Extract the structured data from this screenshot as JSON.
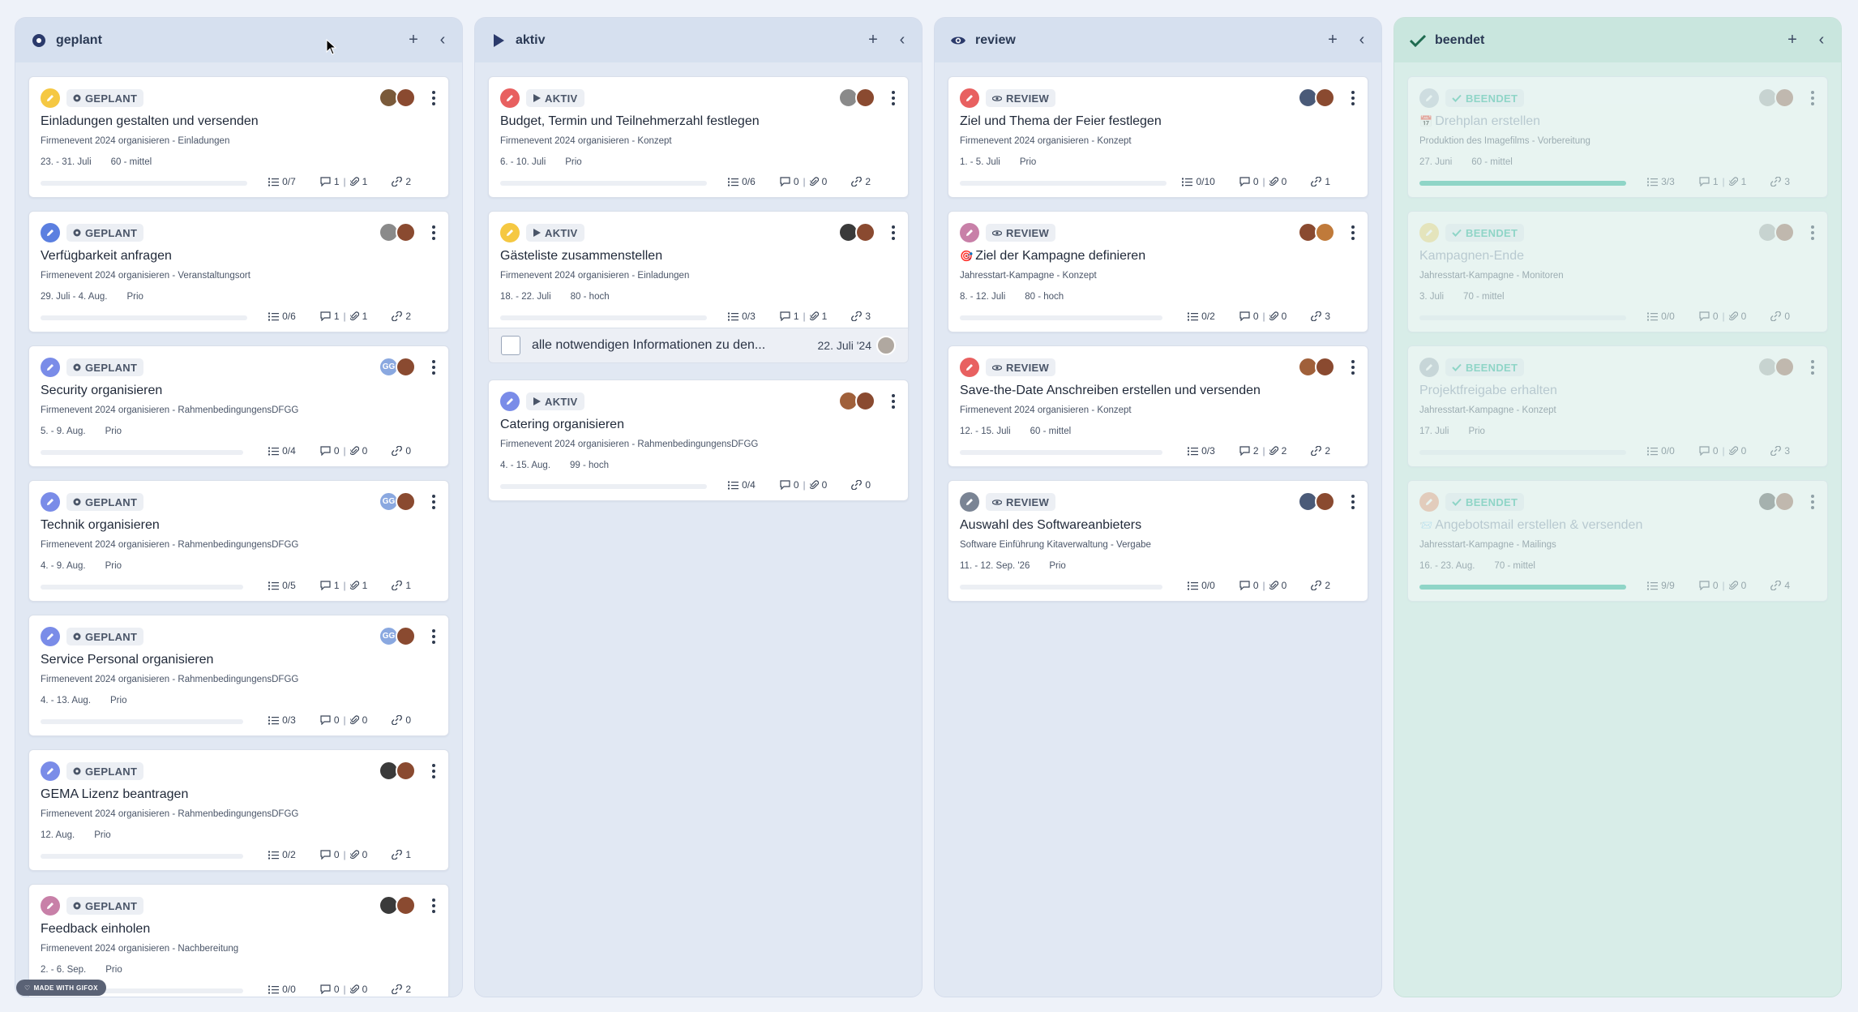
{
  "columns": [
    {
      "id": "geplant",
      "title": "geplant",
      "icon": "circle-dot-icon",
      "cards": [
        {
          "edit_color": "#f5c842",
          "status": "GEPLANT",
          "status_icon": "circle-dot-icon",
          "title": "Einladungen gestalten und versenden",
          "project": "Firmenevent 2024 organisieren - Einladungen",
          "date": "23. - 31. Juli",
          "prio": "60 - mittel",
          "checklist": "0/7",
          "comments": "1",
          "files": "1",
          "links": "2",
          "progress": 0,
          "avatars": [
            "#7a5a3a",
            "#8a4a30"
          ]
        },
        {
          "edit_color": "#5b7fe0",
          "status": "GEPLANT",
          "status_icon": "circle-dot-icon",
          "title": "Verfügbarkeit anfragen",
          "project": "Firmenevent 2024 organisieren - Veranstaltungsort",
          "date": "29. Juli - 4. Aug.",
          "prio": "Prio",
          "checklist": "0/6",
          "comments": "1",
          "files": "1",
          "links": "2",
          "progress": 0,
          "avatars": [
            "#8a8a8a",
            "#8a4a30"
          ]
        },
        {
          "edit_color": "#7a8ce8",
          "status": "GEPLANT",
          "status_icon": "circle-dot-icon",
          "title": "Security organisieren",
          "project": "Firmenevent 2024 organisieren - RahmenbedingungensDFGG",
          "date": "5. - 9. Aug.",
          "prio": "Prio",
          "checklist": "0/4",
          "comments": "0",
          "files": "0",
          "links": "0",
          "progress": 0,
          "avatars": [
            "#8aa8e0",
            "#8a4a30"
          ],
          "initials": "GG"
        },
        {
          "edit_color": "#7a8ce8",
          "status": "GEPLANT",
          "status_icon": "circle-dot-icon",
          "title": "Technik organisieren",
          "project": "Firmenevent 2024 organisieren - RahmenbedingungensDFGG",
          "date": "4. - 9. Aug.",
          "prio": "Prio",
          "checklist": "0/5",
          "comments": "1",
          "files": "1",
          "links": "1",
          "progress": 0,
          "avatars": [
            "#8aa8e0",
            "#8a4a30"
          ],
          "initials": "GG"
        },
        {
          "edit_color": "#7a8ce8",
          "status": "GEPLANT",
          "status_icon": "circle-dot-icon",
          "title": "Service Personal organisieren",
          "project": "Firmenevent 2024 organisieren - RahmenbedingungensDFGG",
          "date": "4. - 13. Aug.",
          "prio": "Prio",
          "checklist": "0/3",
          "comments": "0",
          "files": "0",
          "links": "0",
          "progress": 0,
          "avatars": [
            "#8aa8e0",
            "#8a4a30"
          ],
          "initials": "GG"
        },
        {
          "edit_color": "#7a8ce8",
          "status": "GEPLANT",
          "status_icon": "circle-dot-icon",
          "title": "GEMA Lizenz beantragen",
          "project": "Firmenevent 2024 organisieren - RahmenbedingungensDFGG",
          "date": "12. Aug.",
          "prio": "Prio",
          "checklist": "0/2",
          "comments": "0",
          "files": "0",
          "links": "1",
          "progress": 0,
          "avatars": [
            "#3a3a3a",
            "#8a4a30"
          ]
        },
        {
          "edit_color": "#c880a8",
          "status": "GEPLANT",
          "status_icon": "circle-dot-icon",
          "title": "Feedback einholen",
          "project": "Firmenevent 2024 organisieren - Nachbereitung",
          "date": "2. - 6. Sep.",
          "prio": "Prio",
          "checklist": "0/0",
          "comments": "0",
          "files": "0",
          "links": "2",
          "progress": 0,
          "avatars": [
            "#3a3a3a",
            "#8a4a30"
          ]
        }
      ]
    },
    {
      "id": "aktiv",
      "title": "aktiv",
      "icon": "play-icon",
      "cards": [
        {
          "edit_color": "#e86060",
          "status": "AKTIV",
          "status_icon": "play-icon",
          "title": "Budget, Termin und Teilnehmerzahl festlegen",
          "project": "Firmenevent 2024 organisieren - Konzept",
          "date": "6. - 10. Juli",
          "prio": "Prio",
          "checklist": "0/6",
          "comments": "0",
          "files": "0",
          "links": "2",
          "progress": 0,
          "avatars": [
            "#8a8a8a",
            "#8a4a30"
          ]
        },
        {
          "edit_color": "#f5c842",
          "status": "AKTIV",
          "status_icon": "play-icon",
          "title": "Gästeliste zusammenstellen",
          "project": "Firmenevent 2024 organisieren - Einladungen",
          "date": "18. - 22. Juli",
          "prio": "80 - hoch",
          "checklist": "0/3",
          "comments": "1",
          "files": "1",
          "links": "3",
          "progress": 0,
          "avatars": [
            "#3a3a3a",
            "#8a4a30"
          ]
        },
        {
          "edit_color": "#7a8ce8",
          "status": "AKTIV",
          "status_icon": "play-icon",
          "title": "Catering organisieren",
          "project": "Firmenevent 2024 organisieren - RahmenbedingungensDFGG",
          "date": "4. - 15. Aug.",
          "prio": "99 - hoch",
          "checklist": "0/4",
          "comments": "0",
          "files": "0",
          "links": "0",
          "progress": 0,
          "avatars": [
            "#a0603a",
            "#8a4a30"
          ]
        }
      ],
      "subtask": {
        "text": "alle notwendigen Informationen zu den...",
        "date": "22. Juli '24"
      }
    },
    {
      "id": "review",
      "title": "review",
      "icon": "eye-icon",
      "cards": [
        {
          "edit_color": "#e86060",
          "status": "REVIEW",
          "status_icon": "eye-icon",
          "title": "Ziel und Thema der Feier festlegen",
          "project": "Firmenevent 2024 organisieren - Konzept",
          "date": "1. - 5. Juli",
          "prio": "Prio",
          "checklist": "0/10",
          "comments": "0",
          "files": "0",
          "links": "1",
          "progress": 0,
          "avatars": [
            "#4a5a78",
            "#8a4a30"
          ]
        },
        {
          "edit_color": "#c880a8",
          "status": "REVIEW",
          "status_icon": "eye-icon",
          "title": "Ziel der Kampagne definieren",
          "emoji": "🎯",
          "project": "Jahresstart-Kampagne - Konzept",
          "date": "8. - 12. Juli",
          "prio": "80 - hoch",
          "checklist": "0/2",
          "comments": "0",
          "files": "0",
          "links": "3",
          "progress": 0,
          "avatars": [
            "#8a4a30",
            "#c07a3a"
          ]
        },
        {
          "edit_color": "#e86060",
          "status": "REVIEW",
          "status_icon": "eye-icon",
          "title": "Save-the-Date Anschreiben erstellen und versenden",
          "project": "Firmenevent 2024 organisieren - Konzept",
          "date": "12. - 15. Juli",
          "prio": "60 - mittel",
          "checklist": "0/3",
          "comments": "2",
          "files": "2",
          "links": "2",
          "progress": 0,
          "avatars": [
            "#a0603a",
            "#8a4a30"
          ]
        },
        {
          "edit_color": "#7a8494",
          "status": "REVIEW",
          "status_icon": "eye-icon",
          "title": "Auswahl des Softwareanbieters",
          "project": "Software Einführung Kitaverwaltung - Vergabe",
          "date": "11. - 12. Sep. '26",
          "prio": "Prio",
          "checklist": "0/0",
          "comments": "0",
          "files": "0",
          "links": "2",
          "progress": 0,
          "avatars": [
            "#4a5a78",
            "#8a4a30"
          ]
        }
      ]
    },
    {
      "id": "beendet",
      "title": "beendet",
      "icon": "check-icon",
      "cards": [
        {
          "edit_color": "#c0c8d4",
          "status": "BEENDET",
          "status_icon": "check-icon",
          "title": "Drehplan erstellen",
          "emoji": "📅",
          "project": "Produktion des Imagefilms - Vorbereitung",
          "date": "27. Juni",
          "prio": "60 - mittel",
          "checklist": "3/3",
          "comments": "1",
          "files": "1",
          "links": "3",
          "progress": 1,
          "avatars": [
            "#b0b0b0",
            "#a07060"
          ]
        },
        {
          "edit_color": "#f5d880",
          "status": "BEENDET",
          "status_icon": "check-icon",
          "title": "Kampagnen-Ende",
          "project": "Jahresstart-Kampagne - Monitoren",
          "date": "3. Juli",
          "prio": "70 - mittel",
          "checklist": "0/0",
          "comments": "0",
          "files": "0",
          "links": "0",
          "progress": 0,
          "avatars": [
            "#b0b0b0",
            "#a07060"
          ]
        },
        {
          "edit_color": "#b0b8c4",
          "status": "BEENDET",
          "status_icon": "check-icon",
          "title": "Projektfreigabe erhalten",
          "project": "Jahresstart-Kampagne - Konzept",
          "date": "17. Juli",
          "prio": "Prio",
          "checklist": "0/0",
          "comments": "0",
          "files": "0",
          "links": "3",
          "progress": 0,
          "avatars": [
            "#b0b0b0",
            "#a07060"
          ]
        },
        {
          "edit_color": "#f0a080",
          "status": "BEENDET",
          "status_icon": "check-icon",
          "title": "Angebotsmail erstellen & versenden",
          "emoji": "📨",
          "project": "Jahresstart-Kampagne - Mailings",
          "date": "16. - 23. Aug.",
          "prio": "70 - mittel",
          "checklist": "9/9",
          "comments": "0",
          "files": "0",
          "links": "4",
          "progress": 1,
          "avatars": [
            "#606060",
            "#a07060"
          ]
        }
      ]
    }
  ],
  "footer": {
    "made_with": "MADE WITH GIFOX"
  },
  "colors": {
    "progress": "#2bb59a",
    "header_blue": "#d6e0ef",
    "header_green": "#c9e6de"
  }
}
